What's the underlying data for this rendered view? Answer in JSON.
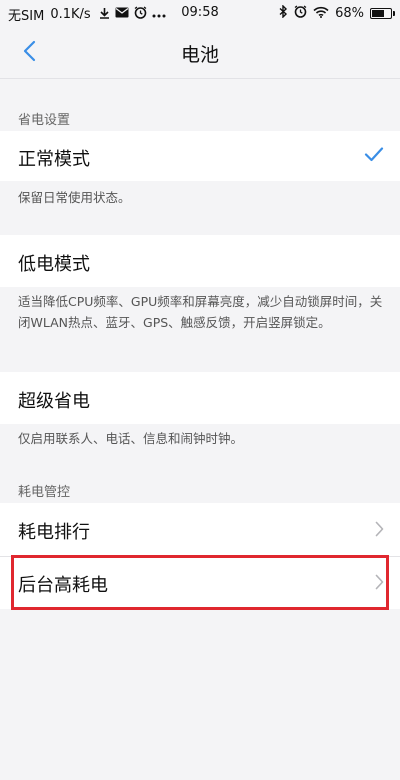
{
  "status_bar": {
    "sim": "无SIM",
    "speed": "0.1K/s",
    "time": "09:58",
    "battery_percent": "68%",
    "battery_level": 0.68,
    "icons": [
      "download-icon",
      "mail-icon",
      "alarm-icon",
      "more-icon",
      "bluetooth-icon",
      "alarm-icon",
      "wifi-icon",
      "battery-icon"
    ]
  },
  "title_bar": {
    "title": "电池",
    "back_icon": "chevron-left-icon"
  },
  "sections": {
    "power_saving_header": "省电设置",
    "power_control_header": "耗电管控"
  },
  "modes": {
    "normal": {
      "label": "正常模式",
      "description": "保留日常使用状态。",
      "selected": true
    },
    "low_power": {
      "label": "低电模式",
      "description": "适当降低CPU频率、GPU频率和屏幕亮度，减少自动锁屏时间，关闭WLAN热点、蓝牙、GPS、触感反馈，开启竖屏锁定。"
    },
    "super_saver": {
      "label": "超级省电",
      "description": "仅启用联系人、电话、信息和闹钟时钟。"
    }
  },
  "control": {
    "ranking": {
      "label": "耗电排行"
    },
    "background": {
      "label": "后台高耗电"
    }
  },
  "colors": {
    "accent": "#3a8ee6",
    "highlight": "#e0272f",
    "background": "#f4f4f6"
  }
}
